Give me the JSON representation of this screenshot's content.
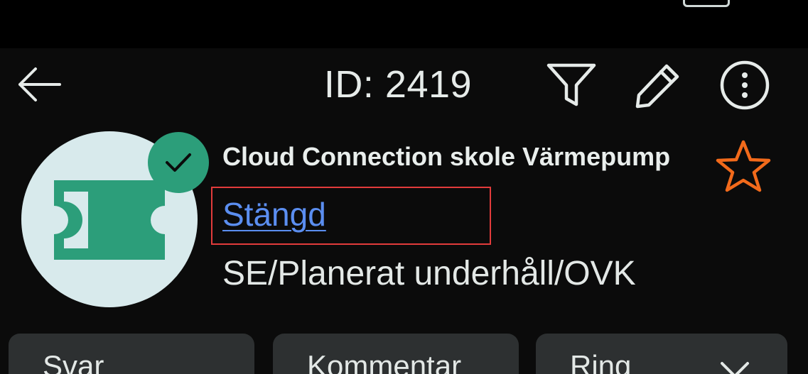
{
  "appbar": {
    "title": "ID: 2419",
    "icons": [
      "arrow-back-icon",
      "filter-icon",
      "pencil-icon",
      "more-vertical-icon"
    ]
  },
  "ticket": {
    "subject": "Cloud Connection skole Värmepump",
    "status": "Stängd",
    "category": "SE/Planerat underhåll/OVK",
    "avatar_icon": "ticket-icon",
    "badge_icon": "check-icon",
    "favorite_icon": "star-outline-icon"
  },
  "actions": {
    "reply": "Svar",
    "comment": "Kommentar",
    "call": "Ring",
    "call_icon": "chevron-down-icon"
  },
  "colors": {
    "background": "#000000",
    "surface": "#0b0b0b",
    "text": "#e6ebe9",
    "link": "#5b8ef0",
    "accent_green": "#2c9e7a",
    "avatar_bg": "#d8eaec",
    "star": "#f26a1b",
    "button_bg": "#2d3031",
    "highlight_border": "#e23b3b"
  }
}
